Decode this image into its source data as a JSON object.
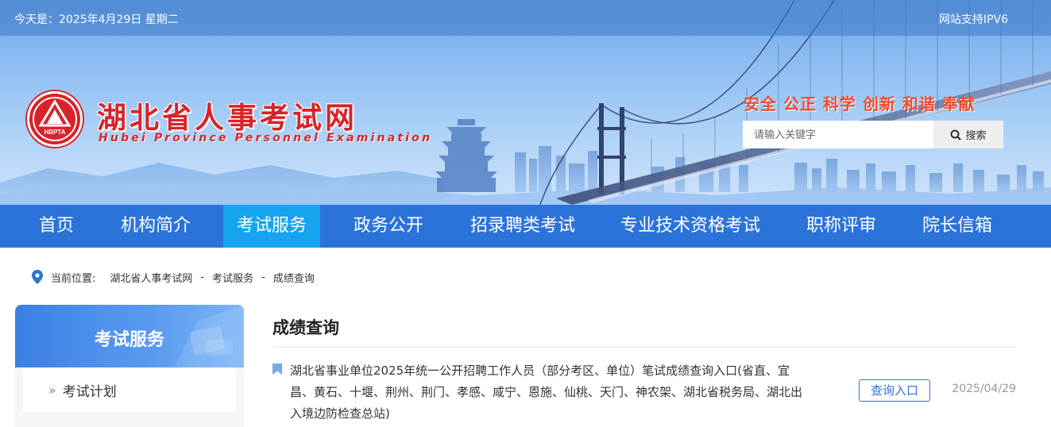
{
  "topbar": {
    "date_text": "今天是：2025年4月29日 星期二",
    "ipv6_text": "网站支持IPV6"
  },
  "brand": {
    "title_cn": "湖北省人事考试网",
    "title_en": "Hubei Province Personnel Examination",
    "logo_text": "HBPTA",
    "accent_color": "#d8232a"
  },
  "slogan": "安全 公正 科学 创新 和谐 奉献",
  "search": {
    "placeholder": "请输入关键字",
    "button_label": "搜索"
  },
  "nav": {
    "items": [
      {
        "label": "首页"
      },
      {
        "label": "机构简介"
      },
      {
        "label": "考试服务"
      },
      {
        "label": "政务公开"
      },
      {
        "label": "招录聘类考试"
      },
      {
        "label": "专业技术资格考试"
      },
      {
        "label": "职称评审"
      },
      {
        "label": "院长信箱"
      }
    ],
    "active_index": 2,
    "bg_color": "#2c73d9",
    "active_color": "#16a4f0"
  },
  "breadcrumb": {
    "prefix": "当前位置:",
    "items": [
      "湖北省人事考试网",
      "考试服务",
      "成绩查询"
    ],
    "separator": "-"
  },
  "sidebar": {
    "title": "考试服务",
    "items": [
      {
        "label": "考试计划"
      }
    ]
  },
  "main": {
    "title": "成绩查询",
    "items": [
      {
        "text": "湖北省事业单位2025年统一公开招聘工作人员（部分考区、单位）笔试成绩查询入口(省直、宜昌、黄石、十堰、荆州、荆门、孝感、咸宁、恩施、仙桃、天门、神农架、湖北省税务局、湖北出入境边防检查总站)",
        "button_label": "查询入口",
        "date": "2025/04/29"
      }
    ]
  }
}
